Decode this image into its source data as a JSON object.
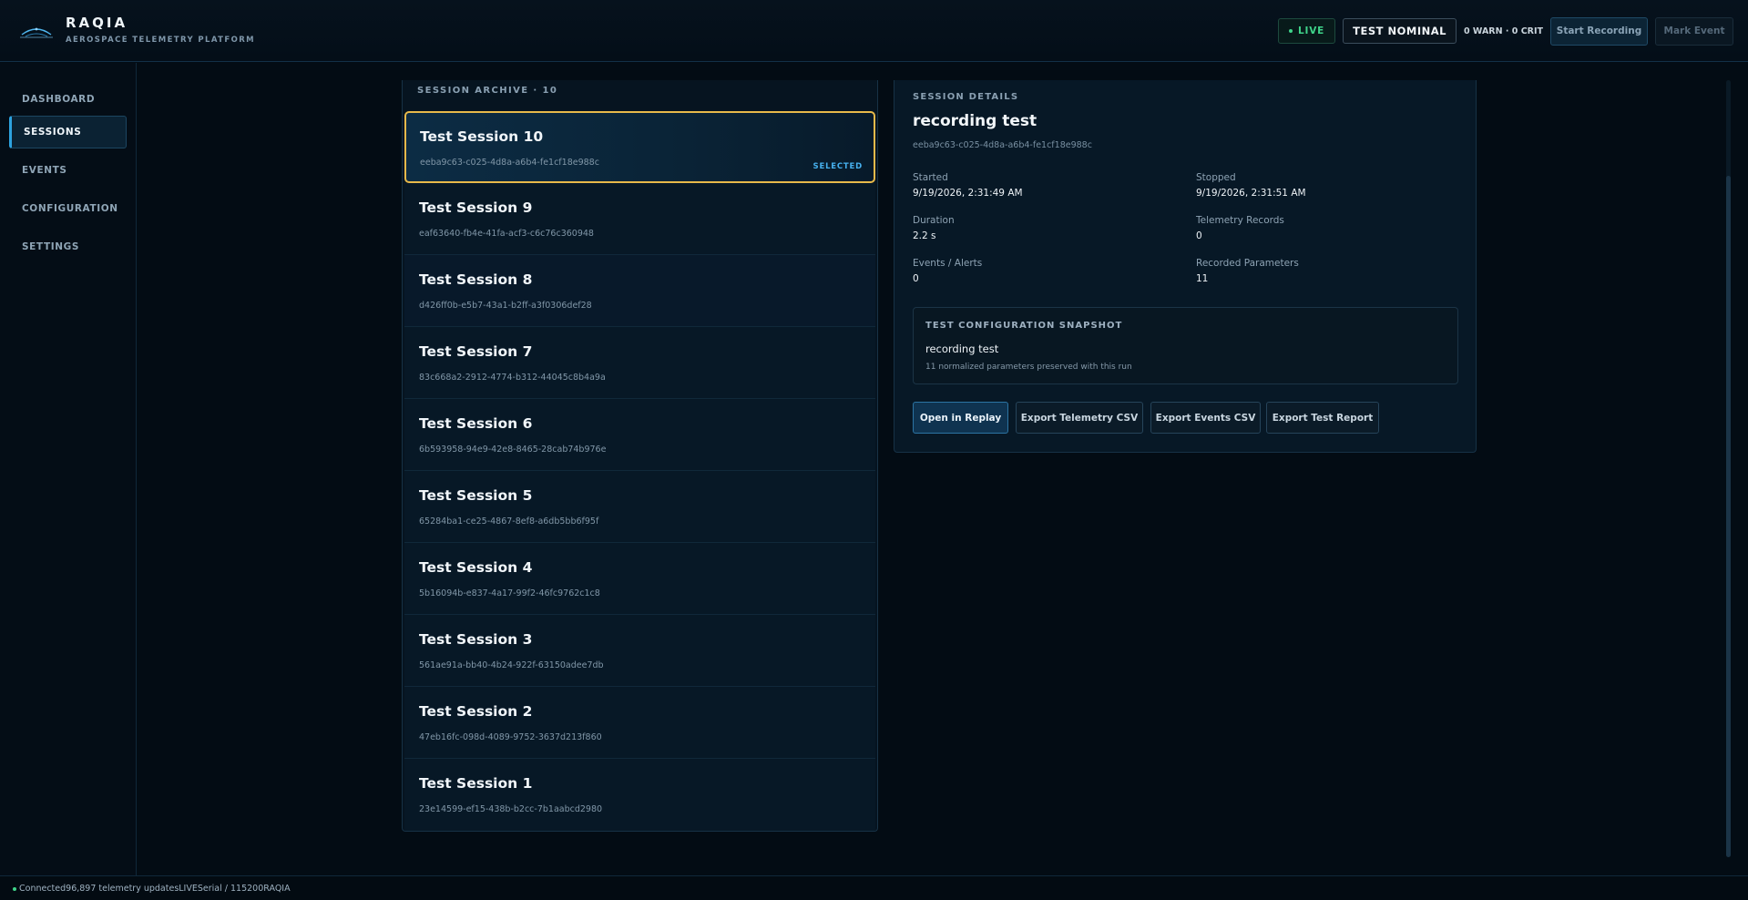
{
  "app": {
    "name": "RAQIA",
    "subtitle": "AEROSPACE TELEMETRY PLATFORM"
  },
  "header": {
    "live_label": "LIVE",
    "status_label": "TEST NOMINAL",
    "alerts_text": "0 WARN · 0 CRIT",
    "start_recording_label": "Start Recording",
    "mark_event_label": "Mark Event",
    "live_color": "#3fd48a"
  },
  "sidebar": {
    "items": [
      {
        "label": "DASHBOARD",
        "active": false
      },
      {
        "label": "SESSIONS",
        "active": true
      },
      {
        "label": "EVENTS",
        "active": false
      },
      {
        "label": "CONFIGURATION",
        "active": false
      },
      {
        "label": "SETTINGS",
        "active": false
      }
    ]
  },
  "archive": {
    "title": "SESSION ARCHIVE · 10",
    "selected_label": "SELECTED",
    "sessions": [
      {
        "name": "Test Session 10",
        "id": "eeba9c63-c025-4d8a-a6b4-fe1cf18e988c",
        "selected": true
      },
      {
        "name": "Test Session 9",
        "id": "eaf63640-fb4e-41fa-acf3-c6c76c360948",
        "selected": false
      },
      {
        "name": "Test Session 8",
        "id": "d426ff0b-e5b7-43a1-b2ff-a3f0306def28",
        "selected": false
      },
      {
        "name": "Test Session 7",
        "id": "83c668a2-2912-4774-b312-44045c8b4a9a",
        "selected": false
      },
      {
        "name": "Test Session 6",
        "id": "6b593958-94e9-42e8-8465-28cab74b976e",
        "selected": false
      },
      {
        "name": "Test Session 5",
        "id": "65284ba1-ce25-4867-8ef8-a6db5bb6f95f",
        "selected": false
      },
      {
        "name": "Test Session 4",
        "id": "5b16094b-e837-4a17-99f2-46fc9762c1c8",
        "selected": false
      },
      {
        "name": "Test Session 3",
        "id": "561ae91a-bb40-4b24-922f-63150adee7db",
        "selected": false
      },
      {
        "name": "Test Session 2",
        "id": "47eb16fc-098d-4089-9752-3637d213f860",
        "selected": false
      },
      {
        "name": "Test Session 1",
        "id": "23e14599-ef15-438b-b2cc-7b1aabcd2980",
        "selected": false
      }
    ]
  },
  "details": {
    "section_label": "SESSION DETAILS",
    "title": "recording test",
    "id": "eeba9c63-c025-4d8a-a6b4-fe1cf18e988c",
    "started_label": "Started",
    "started_value": "9/19/2026, 2:31:49 AM",
    "stopped_label": "Stopped",
    "stopped_value": "9/19/2026, 2:31:51 AM",
    "duration_label": "Duration",
    "duration_value": "2.2 s",
    "records_label": "Telemetry Records",
    "records_value": "0",
    "events_label": "Events / Alerts",
    "events_value": "0",
    "params_label": "Recorded Parameters",
    "params_value": "11",
    "snapshot": {
      "title": "TEST CONFIGURATION SNAPSHOT",
      "name": "recording test",
      "description": "11 normalized parameters preserved with this run"
    },
    "buttons": {
      "replay": "Open in Replay",
      "export_telemetry": "Export Telemetry CSV",
      "export_events": "Export Events CSV",
      "export_report": "Export Test Report"
    }
  },
  "footer": {
    "connected": "Connected",
    "updates": "96,897 telemetry updates",
    "mode": "LIVE",
    "port": "Serial / 115200",
    "brand": "RAQIA"
  },
  "colors": {
    "accent": "#2da3e0",
    "selected_border": "#e8b94a",
    "background": "#030c14"
  }
}
